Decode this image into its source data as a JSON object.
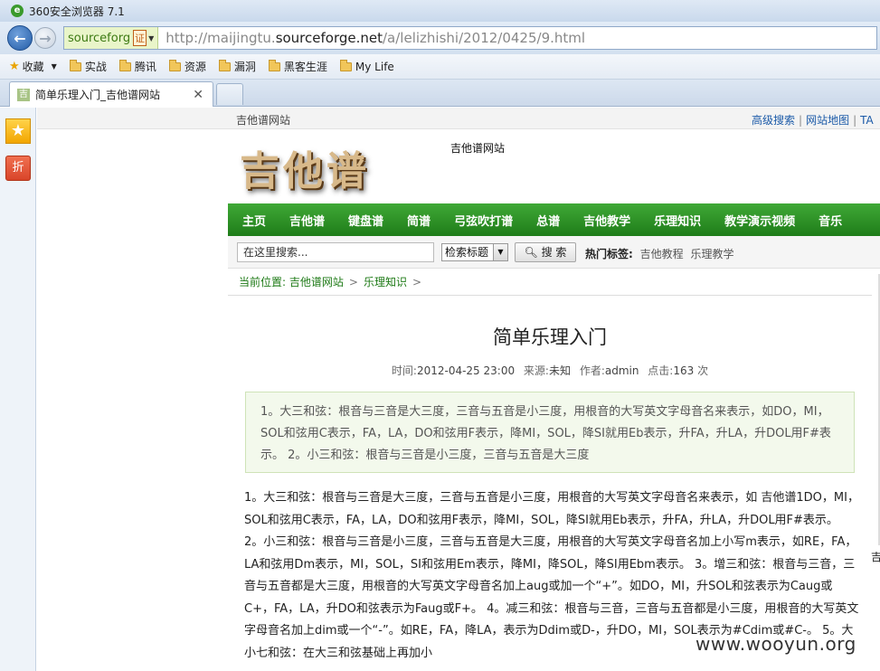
{
  "browser": {
    "title": "360安全浏览器 7.1",
    "cert_label": "sourceforg",
    "cert_badge": "证",
    "url_prefix": "http://maijingtu.",
    "url_domain": "sourceforge.net",
    "url_path": "/a/lelizhishi/2012/0425/9.html",
    "bookmarks": [
      "收藏",
      "实战",
      "腾讯",
      "资源",
      "漏洞",
      "黑客生涯",
      "My Life"
    ],
    "tab_title": "简单乐理入门_吉他谱网站",
    "tab_favicon": "吉",
    "side_zhe": "折"
  },
  "site": {
    "name": "吉他谱网站",
    "top_links": [
      "高级搜索",
      "网站地图",
      "TA"
    ],
    "logo_text": "吉他谱",
    "logo_tag": "吉他谱网站",
    "nav": [
      "主页",
      "吉他谱",
      "键盘谱",
      "简谱",
      "弓弦吹打谱",
      "总谱",
      "吉他教学",
      "乐理知识",
      "教学演示视频",
      "音乐"
    ],
    "search": {
      "placeholder": "在这里搜索...",
      "select_value": "检索标题",
      "button": "搜 索",
      "hot_label": "热门标签:",
      "hot_tags": [
        "吉他教程",
        "乐理教学"
      ]
    },
    "breadcrumb": {
      "prefix": "当前位置:",
      "items": [
        "吉他谱网站",
        "乐理知识"
      ]
    }
  },
  "article": {
    "title": "简单乐理入门",
    "meta": {
      "time_label": "时间:",
      "time": "2012-04-25 23:00",
      "source_label": "来源:",
      "source": "未知",
      "author_label": "作者:",
      "author": "admin",
      "clicks_label": "点击:",
      "clicks": "163",
      "clicks_unit": "次"
    },
    "summary": "1。大三和弦：根音与三音是大三度，三音与五音是小三度，用根音的大写英文字母音名来表示，如DO，MI，SOL和弦用C表示，FA，LA，DO和弦用F表示，降MI，SOL，降SI就用Eb表示，升FA，升LA，升DOL用F#表示。 2。小三和弦：根音与三音是小三度，三音与五音是大三度",
    "body": "1。大三和弦：根音与三音是大三度，三音与五音是小三度，用根音的大写英文字母音名来表示，如 吉他谱1DO，MI，SOL和弦用C表示，FA，LA，DO和弦用F表示，降MI，SOL，降SI就用Eb表示，升FA，升LA，升DOL用F#表示。 2。小三和弦：根音与三音是小三度，三音与五音是大三度，用根音的大写英文字母音名加上小写m表示，如RE，FA，LA和弦用Dm表示，MI，SOL，SI和弦用Em表示，降MI，降SOL，降SI用Ebm表示。 3。增三和弦：根音与三音，三音与五音都是大三度，用根音的大写英文字母音名加上aug或加一个“+”。如DO，MI，升SOL和弦表示为Caug或C+，FA，LA，升DO和弦表示为Faug或F+。 4。减三和弦：根音与三音，三音与五音都是小三度，用根音的大写英文字母音名加上dim或一个“-”。如RE，FA，降LA，表示为Ddim或D-，升DO，MI，SOL表示为#Cdim或#C-。 5。大小七和弦：在大三和弦基础上再加小"
  },
  "right_cut_text": "吉",
  "watermark": "www.wooyun.org"
}
